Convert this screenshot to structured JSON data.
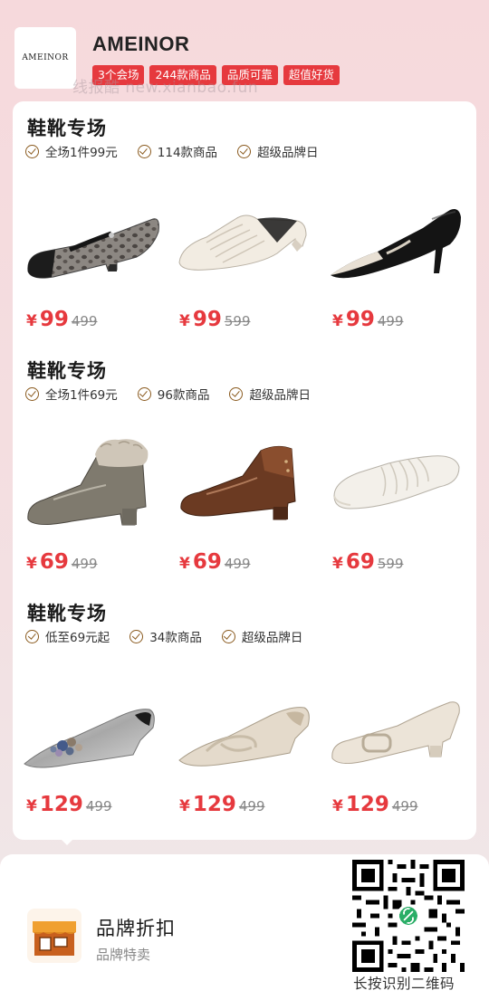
{
  "header": {
    "logo_text": "AMEINOR",
    "brand_name": "AMEINOR",
    "tags": [
      "3个会场",
      "244款商品",
      "品质可靠",
      "超值好货"
    ],
    "watermark": "线报酷 new.xianbao.fun"
  },
  "sections": [
    {
      "title": "鞋靴专场",
      "features": [
        "全场1件99元",
        "114款商品",
        "超级品牌日"
      ],
      "products": [
        {
          "shoe_icon": "leopard-mary-jane-shoe",
          "currency": "¥",
          "price": "99",
          "original_price": "499"
        },
        {
          "shoe_icon": "cream-pleated-mule-shoe",
          "currency": "¥",
          "price": "99",
          "original_price": "599"
        },
        {
          "shoe_icon": "black-patent-kitten-heel-shoe",
          "currency": "¥",
          "price": "99",
          "original_price": "499"
        }
      ]
    },
    {
      "title": "鞋靴专场",
      "features": [
        "全场1件69元",
        "96款商品",
        "超级品牌日"
      ],
      "products": [
        {
          "shoe_icon": "fur-trim-ankle-boot",
          "currency": "¥",
          "price": "69",
          "original_price": "499"
        },
        {
          "shoe_icon": "brown-patent-loafer",
          "currency": "¥",
          "price": "69",
          "original_price": "499"
        },
        {
          "shoe_icon": "white-pleated-slipper",
          "currency": "¥",
          "price": "69",
          "original_price": "599"
        }
      ]
    },
    {
      "title": "鞋靴专场",
      "features": [
        "低至69元起",
        "34款商品",
        "超级品牌日"
      ],
      "products": [
        {
          "shoe_icon": "silver-jeweled-flat",
          "currency": "¥",
          "price": "129",
          "original_price": "499"
        },
        {
          "shoe_icon": "beige-woven-flat",
          "currency": "¥",
          "price": "129",
          "original_price": "499"
        },
        {
          "shoe_icon": "cream-buckle-pump",
          "currency": "¥",
          "price": "129",
          "original_price": "499"
        }
      ]
    }
  ],
  "footer": {
    "title": "品牌折扣",
    "subtitle": "品牌特卖",
    "qr_label": "长按识别二维码"
  },
  "colors": {
    "accent": "#e6393e",
    "check": "#8a5a1e",
    "background": "#f6d9dc"
  }
}
